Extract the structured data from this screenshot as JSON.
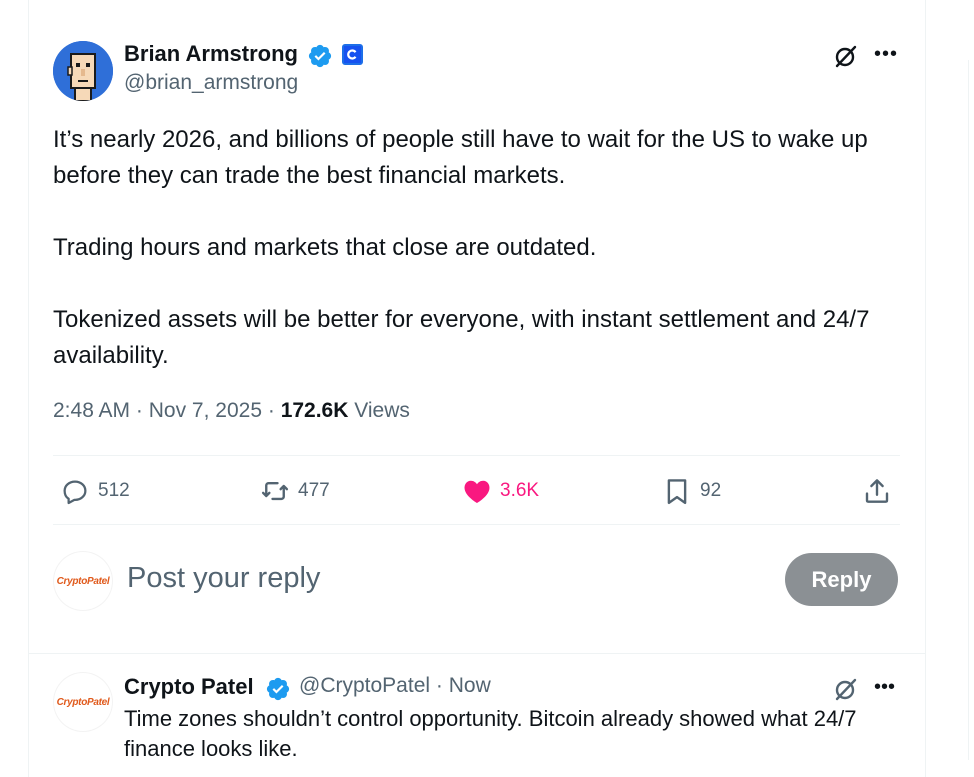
{
  "tweet": {
    "author_name": "Brian Armstrong",
    "author_handle": "@brian_armstrong",
    "paragraphs": [
      "It’s nearly 2026, and billions of people still have to wait for the US to wake up before they can trade the best financial markets.",
      "Trading hours and markets that close are outdated.",
      "Tokenized assets will be better for everyone, with instant settlement and 24/7 availability."
    ],
    "time": "2:48 AM",
    "date": "Nov 7, 2025",
    "views_count": "172.6K",
    "views_label": "Views",
    "separator": "·"
  },
  "actions": {
    "replies": "512",
    "reposts": "477",
    "likes": "3.6K",
    "bookmarks": "92"
  },
  "composer": {
    "avatar_text": "CryptoPatel",
    "placeholder": "Post your reply",
    "reply_button": "Reply"
  },
  "reply_tweet": {
    "avatar_text": "CryptoPatel",
    "author_name": "Crypto Patel",
    "author_handle": "@CryptoPatel",
    "time": "Now",
    "text": "Time zones shouldn’t control opportunity. Bitcoin already showed what 24/7 finance looks like."
  },
  "icons": {
    "verified": "verified-badge-icon",
    "affiliate": "coinbase-affiliate-icon",
    "grok": "grok-icon",
    "more": "more-icon",
    "reply": "reply-icon",
    "repost": "repost-icon",
    "like": "heart-icon",
    "bookmark": "bookmark-icon",
    "share": "share-icon"
  },
  "colors": {
    "verified_blue": "#1d9bf0",
    "like_pink": "#f91880",
    "muted": "#536471",
    "reply_button_bg": "#8b9094"
  }
}
